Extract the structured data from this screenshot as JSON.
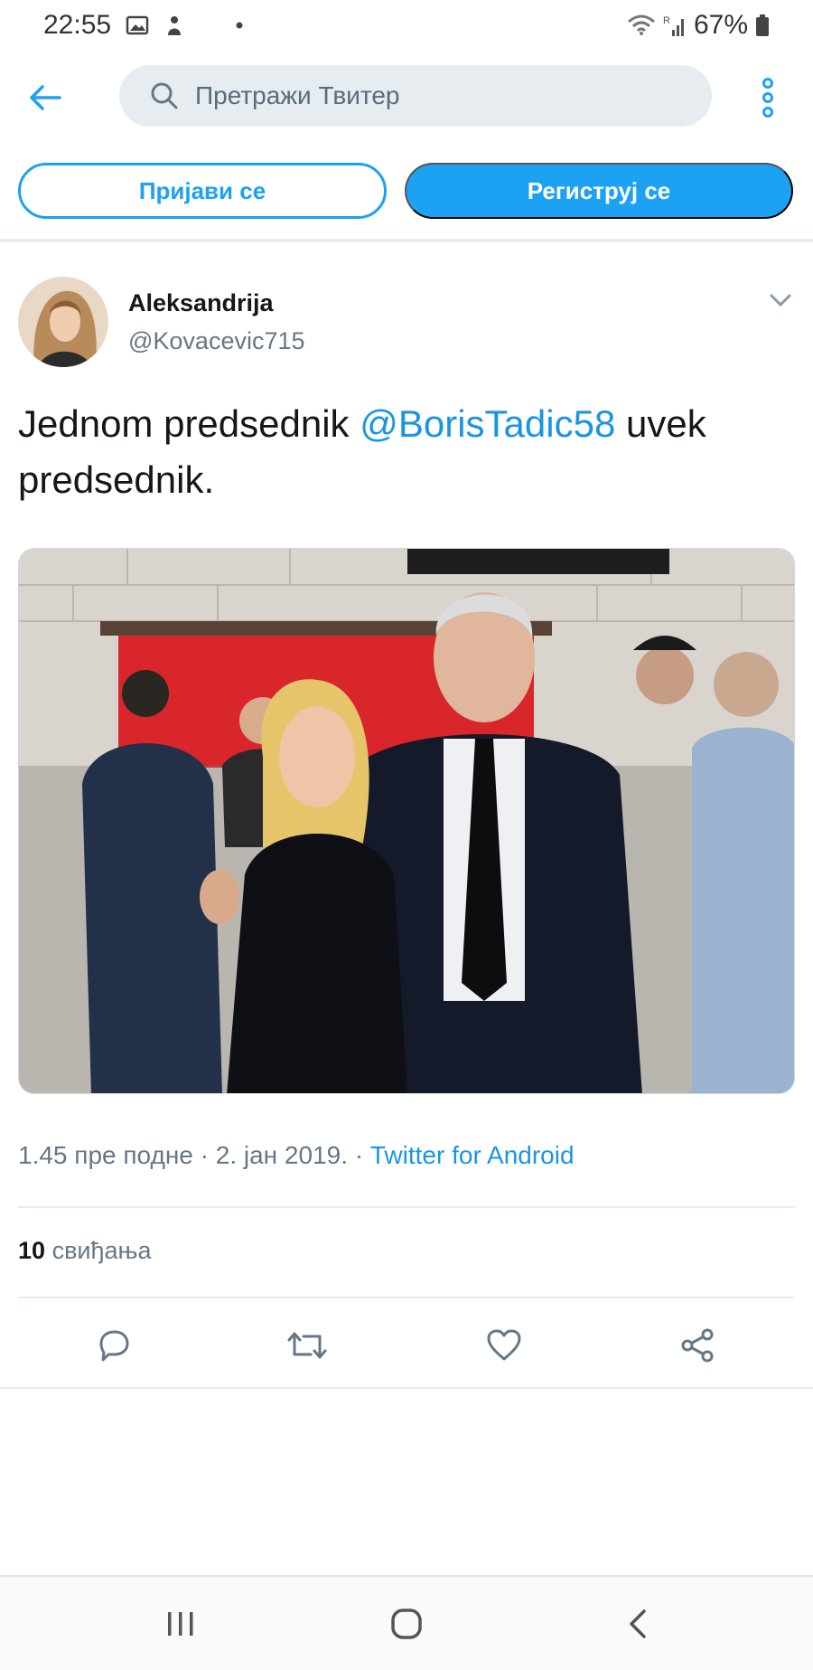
{
  "status_bar": {
    "time": "22:55",
    "signal_text": "R",
    "battery": "67%",
    "icons": [
      "image-icon",
      "notification-icon",
      "dot-icon",
      "wifi-icon",
      "signal-icon",
      "battery-icon"
    ]
  },
  "header": {
    "search_placeholder": "Претражи Твитер",
    "icons": [
      "back-arrow-icon",
      "search-icon",
      "more-vertical-icon"
    ]
  },
  "auth": {
    "login_label": "Пријави се",
    "signup_label": "Региструј се"
  },
  "tweet": {
    "author_name": "Aleksandrija",
    "author_handle": "@Kovacevic715",
    "text_before": "Jednom predsednik ",
    "mention": "@BorisTadic58",
    "text_after": " uvek predsednik.",
    "time": "1.45 пре подне",
    "date": "2. јан 2019.",
    "separator": " · ",
    "source": "Twitter for Android",
    "likes_count": "10",
    "likes_label": "свиђања",
    "photo_icon": "tweet-photo"
  },
  "actions": [
    "reply-icon",
    "retweet-icon",
    "like-icon",
    "share-icon"
  ],
  "nav": [
    "recent-apps-icon",
    "home-icon",
    "back-icon"
  ],
  "colors": {
    "accent": "#1da1f2",
    "link": "#1b95e0",
    "muted": "#657786",
    "search_bg": "#e6ecf0"
  }
}
